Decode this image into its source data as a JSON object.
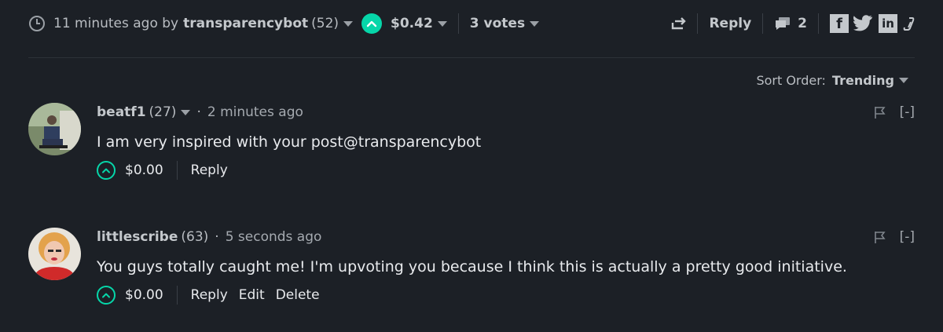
{
  "post_footer": {
    "time_ago": "11 minutes ago by",
    "author": "transparencybot",
    "author_rep": "(52)",
    "payout": "$0.42",
    "votes": "3 votes",
    "reply_label": "Reply",
    "comments_count": "2",
    "social_icons": [
      "facebook-icon",
      "twitter-icon",
      "linkedin-icon",
      "link-icon"
    ]
  },
  "sort": {
    "label": "Sort Order:",
    "value": "Trending"
  },
  "comments": [
    {
      "author": "beatf1",
      "rep": "(27)",
      "time": "2 minutes ago",
      "text": "I am very inspired with your post@transparencybot",
      "payout": "$0.00",
      "collapse": "[-]",
      "actions": [
        "Reply"
      ]
    },
    {
      "author": "littlescribe",
      "rep": "(63)",
      "time": "5 seconds ago",
      "text": "You guys totally caught me! I'm upvoting you because I think this is actually a pretty good initiative.",
      "payout": "$0.00",
      "collapse": "[-]",
      "actions": [
        "Reply",
        "Edit",
        "Delete"
      ]
    }
  ],
  "colors": {
    "background": "#1c2026",
    "accent": "#06d6a9"
  }
}
